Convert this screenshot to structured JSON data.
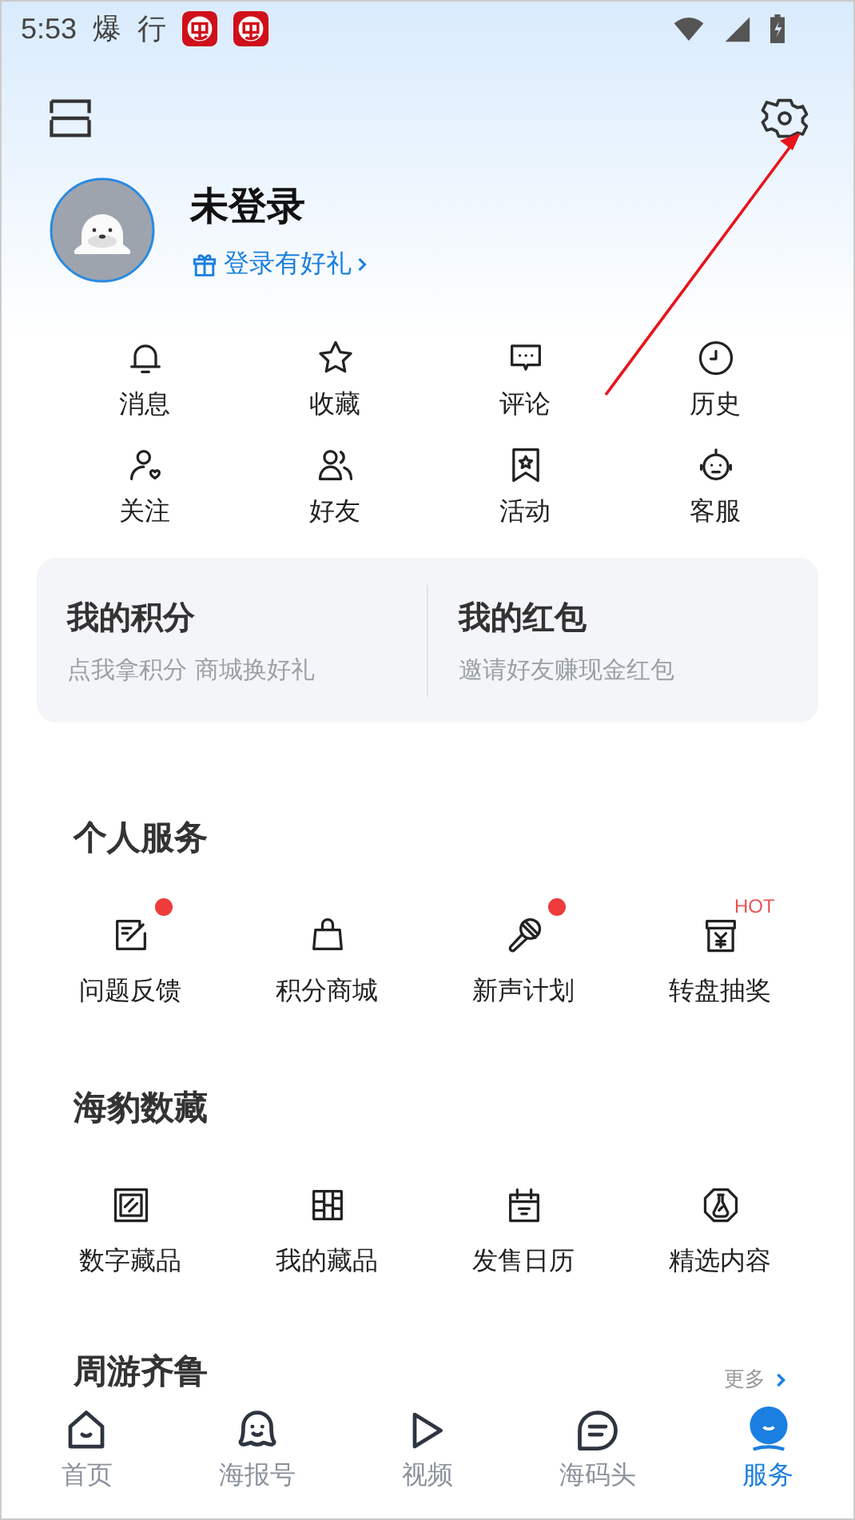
{
  "status_bar": {
    "time": "5:53",
    "notification_glyphs": [
      "爆",
      "行"
    ]
  },
  "profile": {
    "name": "未登录",
    "login_link": "登录有好礼"
  },
  "quick_actions": [
    {
      "label": "消息"
    },
    {
      "label": "收藏"
    },
    {
      "label": "评论"
    },
    {
      "label": "历史"
    },
    {
      "label": "关注"
    },
    {
      "label": "好友"
    },
    {
      "label": "活动"
    },
    {
      "label": "客服"
    }
  ],
  "wallet_cards": [
    {
      "title": "我的积分",
      "subtitle": "点我拿积分 商城换好礼"
    },
    {
      "title": "我的红包",
      "subtitle": "邀请好友赚现金红包"
    }
  ],
  "sections": [
    {
      "title": "个人服务",
      "items": [
        {
          "label": "问题反馈",
          "dot": true
        },
        {
          "label": "积分商城",
          "dot": false
        },
        {
          "label": "新声计划",
          "dot": true
        },
        {
          "label": "转盘抽奖",
          "dot": false,
          "badge": "HOT"
        }
      ]
    },
    {
      "title": "海豹数藏",
      "items": [
        {
          "label": "数字藏品",
          "dot": false
        },
        {
          "label": "我的藏品",
          "dot": false
        },
        {
          "label": "发售日历",
          "dot": false
        },
        {
          "label": "精选内容",
          "dot": false
        }
      ]
    }
  ],
  "partial_section": {
    "title": "周游齐鲁",
    "more": "更多"
  },
  "bottom_nav": [
    {
      "label": "首页",
      "selected": false
    },
    {
      "label": "海报号",
      "selected": false
    },
    {
      "label": "视频",
      "selected": false
    },
    {
      "label": "海码头",
      "selected": false
    },
    {
      "label": "服务",
      "selected": true
    }
  ]
}
